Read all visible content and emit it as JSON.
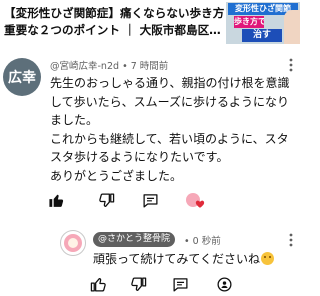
{
  "video": {
    "title_line1": "【変形性ひざ関節症】痛くならない歩き方",
    "title_line2": "重要な２つのポイント ｜ 大阪市都島区…",
    "thumb_top": "変形性ひざ関節",
    "thumb_mid": "歩き方で",
    "thumb_bottom": "治す"
  },
  "comment": {
    "avatar_text": "広幸",
    "author": "@宮崎広幸-n2d",
    "separator": "•",
    "time": "7 時間前",
    "lines": [
      "先生のおっしゃる通り、親指の付け根を意識",
      "して歩いたら、スムーズに歩けるようになり",
      "ました。",
      "これからも継続して、若い頃のように、スタ",
      "スタ歩けるようになりたいです。",
      "ありがとうござました。"
    ]
  },
  "reply": {
    "channel": "@さかとう整骨院",
    "separator": "•",
    "time": "0 秒前",
    "text": "頑張って続けてみてくださいね"
  },
  "icons": {
    "like": "thumbs-up-icon",
    "dislike": "thumbs-down-icon",
    "reply": "comment-icon",
    "share": "share-icon",
    "heart": "creator-heart-icon",
    "more": "more-vertical-icon"
  },
  "colors": {
    "heart": "#e02a3a",
    "chip": "#606060"
  }
}
